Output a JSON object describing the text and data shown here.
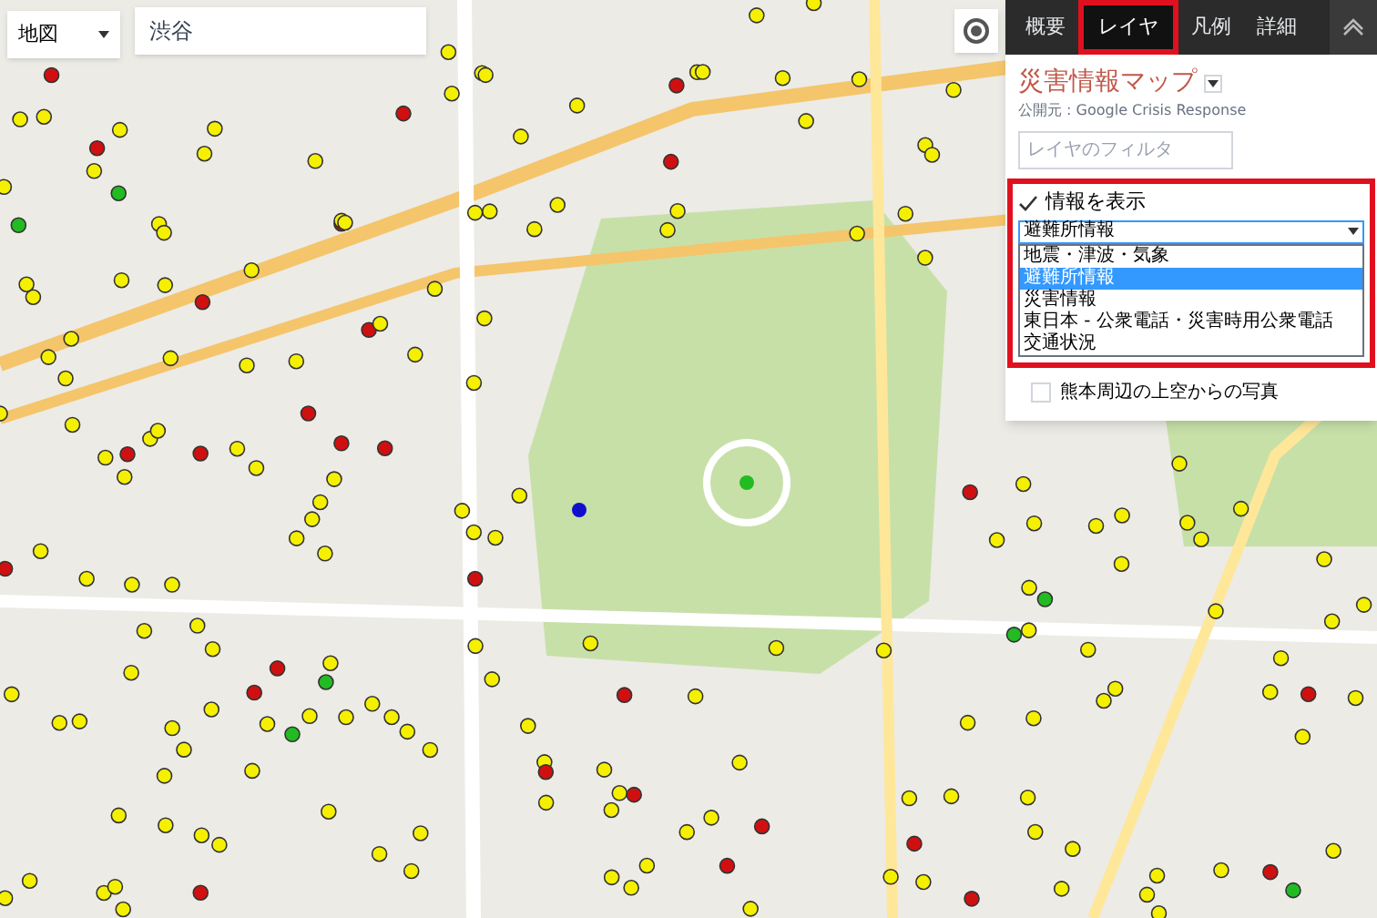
{
  "map_type": {
    "value": "地図"
  },
  "search": {
    "value": "渋谷"
  },
  "panel": {
    "tabs": [
      {
        "label": "概要",
        "selected": false
      },
      {
        "label": "レイヤ",
        "selected": true
      },
      {
        "label": "凡例",
        "selected": false
      },
      {
        "label": "詳細",
        "selected": false
      }
    ],
    "title": "災害情報マップ",
    "publisher": "公開元 : Google Crisis Response",
    "filter": {
      "placeholder": "レイヤのフィルタ"
    },
    "layers": [
      {
        "kind": "group",
        "label": "情報を表示",
        "checked": true,
        "select": {
          "value": "避難所情報",
          "expanded": true,
          "options": [
            {
              "label": "地震・津波・気象",
              "selected": false
            },
            {
              "label": "避難所情報",
              "selected": true
            },
            {
              "label": "災害情報",
              "selected": false
            },
            {
              "label": "東日本 - 公衆電話・災害時用公衆電話",
              "selected": false
            },
            {
              "label": "交通状況",
              "selected": false
            }
          ]
        }
      },
      {
        "kind": "check",
        "label": "熊本周辺の上空からの写真",
        "checked": false
      }
    ]
  }
}
